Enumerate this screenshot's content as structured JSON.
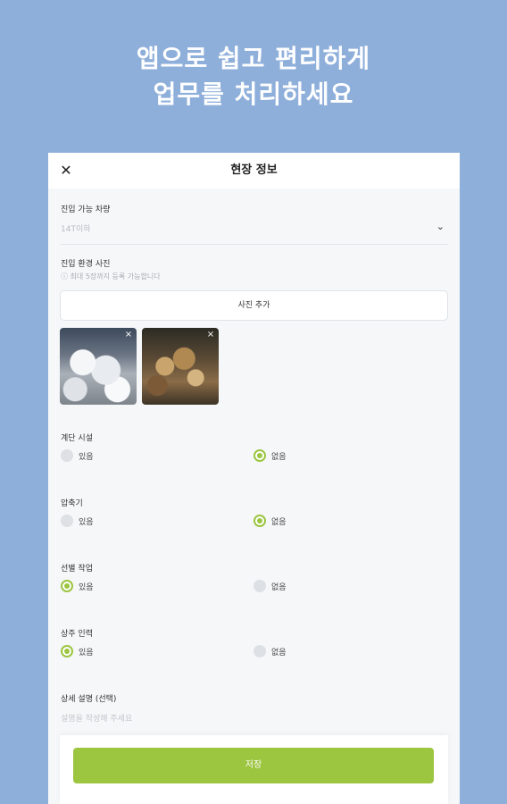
{
  "headline": {
    "line1": "앱으로 쉽고 편리하게",
    "line2": "업무를 처리하세요"
  },
  "header": {
    "close_icon": "close-icon",
    "title": "현장 정보"
  },
  "vehicle": {
    "label": "진입 가능 차량",
    "value": "14T이하",
    "chevron_icon": "chevron-down-icon"
  },
  "photos": {
    "label": "진입 환경 사진",
    "hint": "ⓘ 최대 5장까지 등록 가능합니다",
    "add_button": "사진 추가",
    "remove_glyph": "×"
  },
  "questions": [
    {
      "label": "계단 시설",
      "options": [
        "있음",
        "없음"
      ],
      "selected": "없음"
    },
    {
      "label": "압축기",
      "options": [
        "있음",
        "없음"
      ],
      "selected": "없음"
    },
    {
      "label": "선별 작업",
      "options": [
        "있음",
        "없음"
      ],
      "selected": "있음"
    },
    {
      "label": "상주 인력",
      "options": [
        "있음",
        "없음"
      ],
      "selected": "있음"
    }
  ],
  "description": {
    "label": "상세 설명 (선택)",
    "placeholder": "설명을 작성해 주세요"
  },
  "footer": {
    "save_label": "저장"
  },
  "colors": {
    "background": "#8fafdb",
    "accent": "#9cc540",
    "panel": "#f5f7f9"
  }
}
